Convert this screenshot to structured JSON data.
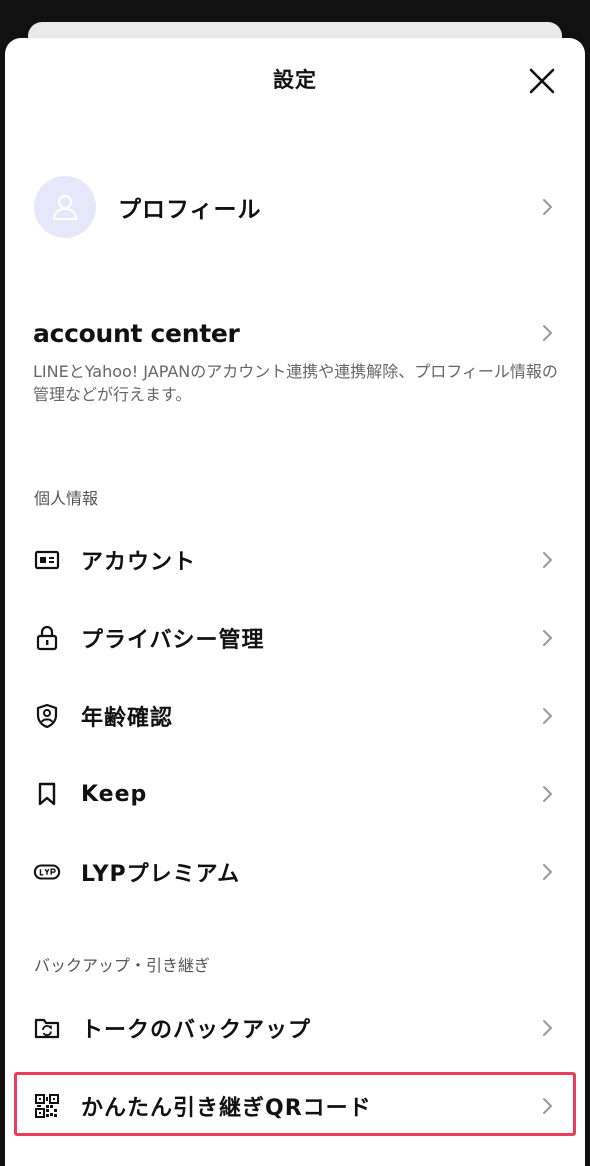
{
  "header": {
    "title": "設定"
  },
  "profile": {
    "label": "プロフィール"
  },
  "account_center": {
    "logo": "account center",
    "description": "LINEとYahoo! JAPANのアカウント連携や連携解除、プロフィール情報の管理などが行えます。"
  },
  "sections": {
    "personal": {
      "title": "個人情報",
      "items": [
        {
          "label": "アカウント",
          "icon": "id-card-icon"
        },
        {
          "label": "プライバシー管理",
          "icon": "lock-icon"
        },
        {
          "label": "年齢確認",
          "icon": "shield-person-icon"
        },
        {
          "label": "Keep",
          "icon": "bookmark-icon"
        },
        {
          "label": "LYPプレミアム",
          "icon": "lyp-badge-icon"
        }
      ]
    },
    "backup": {
      "title": "バックアップ・引き継ぎ",
      "items": [
        {
          "label": "トークのバックアップ",
          "icon": "folder-sync-icon"
        },
        {
          "label": "かんたん引き継ぎQRコード",
          "icon": "qr-code-icon"
        }
      ]
    }
  },
  "colors": {
    "highlight": "#e83e5c",
    "avatar_bg": "#e5e7fb",
    "avatar_icon": "#ffffff"
  }
}
